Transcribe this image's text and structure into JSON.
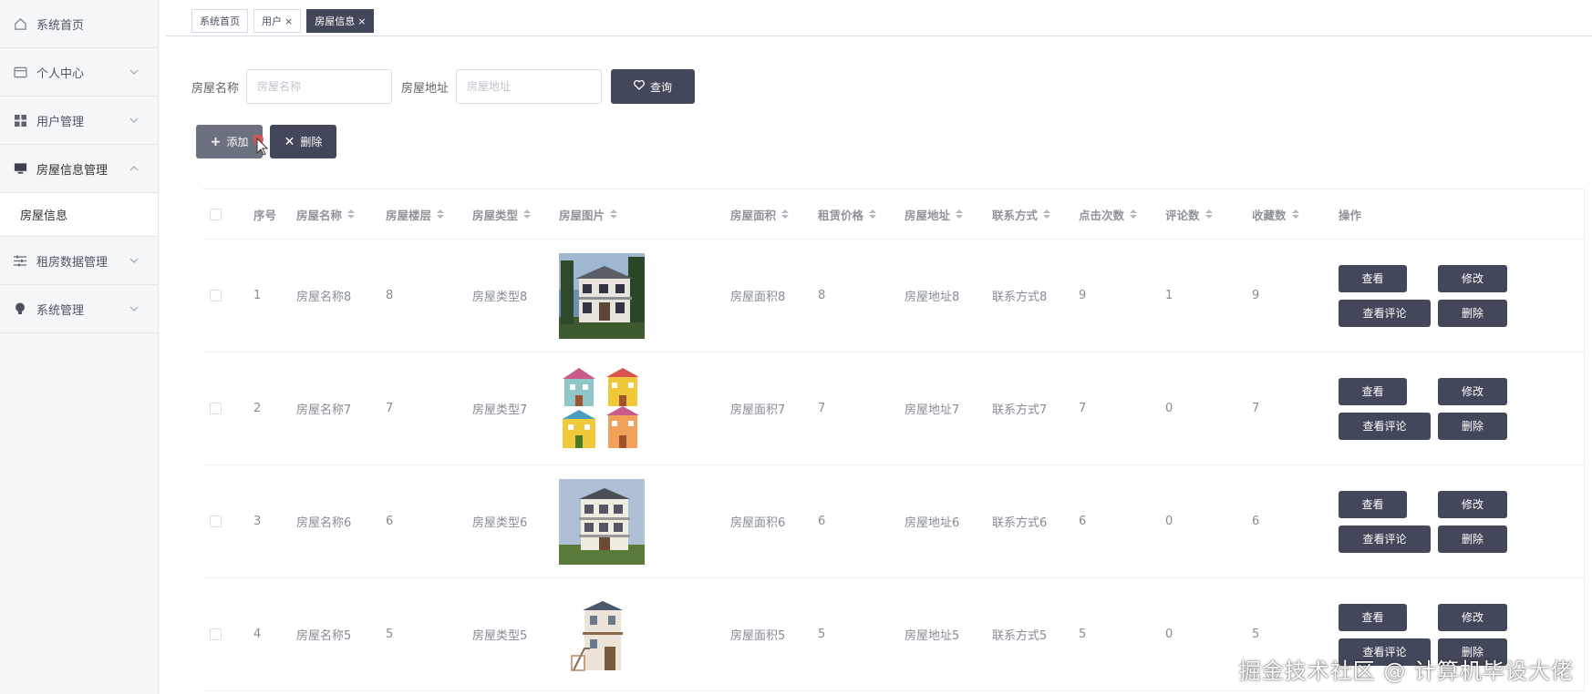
{
  "sidebar": {
    "items": [
      {
        "label": "系统首页"
      },
      {
        "label": "个人中心"
      },
      {
        "label": "用户管理"
      },
      {
        "label": "房屋信息管理"
      },
      {
        "label": "房屋信息"
      },
      {
        "label": "租房数据管理"
      },
      {
        "label": "系统管理"
      }
    ]
  },
  "tabs": [
    {
      "label": "系统首页"
    },
    {
      "label": "用户",
      "close": "×"
    },
    {
      "label": "房屋信息",
      "close": "×"
    }
  ],
  "search": {
    "name_label": "房屋名称",
    "name_placeholder": "房屋名称",
    "addr_label": "房屋地址",
    "addr_placeholder": "房屋地址",
    "query_label": "查询"
  },
  "actions": {
    "add_label": "添加",
    "delete_label": "删除"
  },
  "table": {
    "headers": [
      "序号",
      "房屋名称",
      "房屋楼层",
      "房屋类型",
      "房屋图片",
      "房屋面积",
      "租赁价格",
      "房屋地址",
      "联系方式",
      "点击次数",
      "评论数",
      "收藏数",
      "操作"
    ],
    "rows": [
      {
        "idx": "1",
        "name": "房屋名称8",
        "floor": "8",
        "type": "房屋类型8",
        "area": "房屋面积8",
        "price": "8",
        "addr": "房屋地址8",
        "contact": "联系方式8",
        "clicks": "9",
        "comments": "1",
        "favs": "9",
        "image": "modern-villa-photo"
      },
      {
        "idx": "2",
        "name": "房屋名称7",
        "floor": "7",
        "type": "房屋类型7",
        "area": "房屋面积7",
        "price": "7",
        "addr": "房屋地址7",
        "contact": "联系方式7",
        "clicks": "7",
        "comments": "0",
        "favs": "7",
        "image": "cartoon-houses"
      },
      {
        "idx": "3",
        "name": "房屋名称6",
        "floor": "6",
        "type": "房屋类型6",
        "area": "房屋面积6",
        "price": "6",
        "addr": "房屋地址6",
        "contact": "联系方式6",
        "clicks": "6",
        "comments": "0",
        "favs": "6",
        "image": "three-storey-house-photo"
      },
      {
        "idx": "4",
        "name": "房屋名称5",
        "floor": "5",
        "type": "房屋类型5",
        "area": "房屋面积5",
        "price": "5",
        "addr": "房屋地址5",
        "contact": "联系方式5",
        "clicks": "5",
        "comments": "0",
        "favs": "5",
        "image": "small-house-render"
      }
    ],
    "op_labels": {
      "view": "查看",
      "edit": "修改",
      "review": "查看评论",
      "delete": "删除"
    }
  },
  "watermark": "掘金技术社区 @ 计算机毕设大佬",
  "colors": {
    "dark_button": "#42485a",
    "add_button": "#6b717e",
    "sidebar_bg": "#f5f6f7"
  }
}
